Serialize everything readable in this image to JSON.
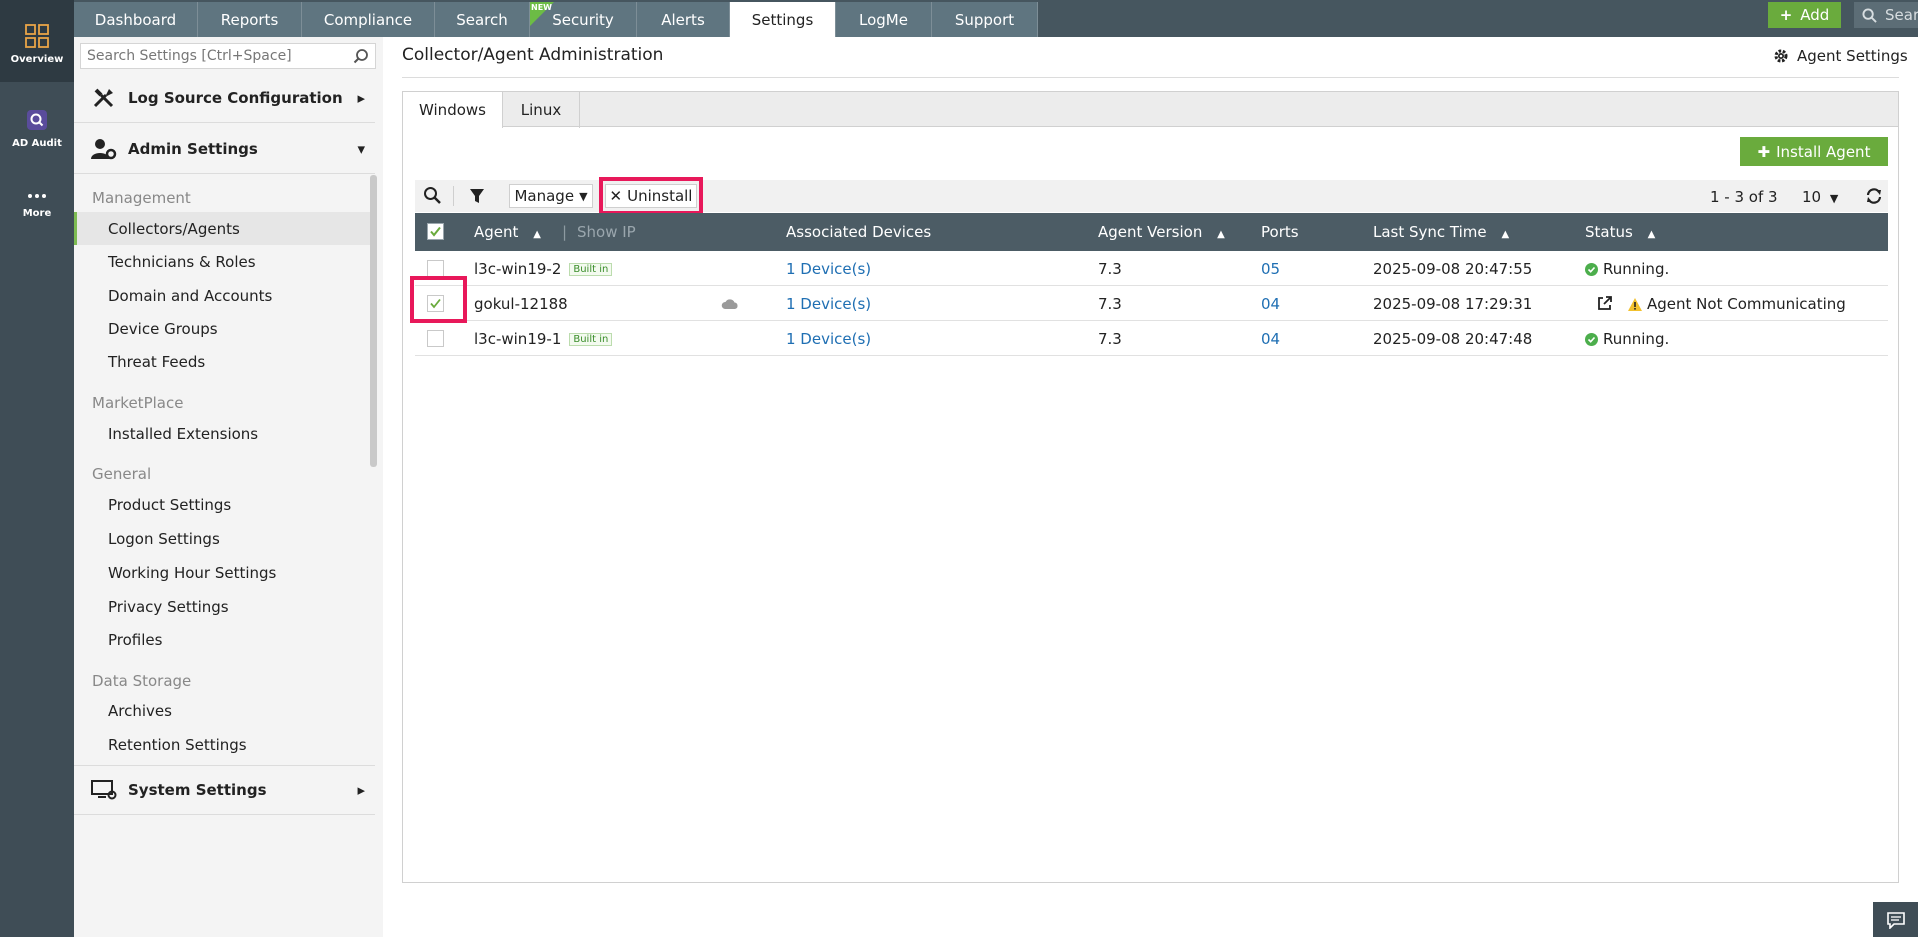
{
  "rail": {
    "items": [
      {
        "label": "Overview",
        "icon": "grid-icon"
      },
      {
        "label": "AD Audit",
        "icon": "ad-audit-icon"
      },
      {
        "label": "More",
        "icon": "more-dots-icon"
      }
    ]
  },
  "topnav": {
    "tabs": [
      "Dashboard",
      "Reports",
      "Compliance",
      "Search",
      "Security",
      "Alerts",
      "Settings",
      "LogMe",
      "Support"
    ],
    "new_badge": "NEW",
    "active_tab": "Settings",
    "add_label": "Add",
    "search_placeholder": "Search"
  },
  "sidebar": {
    "search_placeholder": "Search Settings [Ctrl+Space]",
    "sections": {
      "log_source": "Log Source Configuration",
      "admin": "Admin Settings",
      "system": "System Settings"
    },
    "groups": {
      "management": "Management",
      "marketplace": "MarketPlace",
      "general": "General",
      "data_storage": "Data Storage"
    },
    "items": {
      "collectors": "Collectors/Agents",
      "technicians": "Technicians & Roles",
      "domain": "Domain and Accounts",
      "device_groups": "Device Groups",
      "threat_feeds": "Threat Feeds",
      "installed_ext": "Installed Extensions",
      "product_settings": "Product Settings",
      "logon_settings": "Logon Settings",
      "working_hour": "Working Hour Settings",
      "privacy": "Privacy Settings",
      "profiles": "Profiles",
      "archives": "Archives",
      "retention": "Retention Settings"
    }
  },
  "main": {
    "title": "Collector/Agent Administration",
    "agent_settings": "Agent Settings",
    "os_tabs": [
      "Windows",
      "Linux"
    ],
    "install_agent": "Install Agent",
    "manage": "Manage",
    "uninstall": "Uninstall",
    "pagination": "1 - 3 of 3",
    "page_size": "10",
    "columns": {
      "agent": "Agent",
      "show_ip": "Show IP",
      "devices": "Associated Devices",
      "version": "Agent Version",
      "ports": "Ports",
      "last_sync": "Last Sync Time",
      "status": "Status"
    },
    "built_in": "Built in",
    "rows": [
      {
        "agent": "l3c-win19-2",
        "devices": "1 Device(s)",
        "version": "7.3",
        "ports": "05",
        "last_sync": "2025-09-08 20:47:55",
        "status": "Running."
      },
      {
        "agent": "gokul-12188",
        "devices": "1 Device(s)",
        "version": "7.3",
        "ports": "04",
        "last_sync": "2025-09-08 17:29:31",
        "status": "Agent Not Communicating"
      },
      {
        "agent": "l3c-win19-1",
        "devices": "1 Device(s)",
        "version": "7.3",
        "ports": "04",
        "last_sync": "2025-09-08 20:47:48",
        "status": "Running."
      }
    ]
  },
  "colors": {
    "accent_green": "#6aab3d",
    "highlight": "#e8185a",
    "link": "#1f6fb3",
    "header_bg": "#4c5c65"
  }
}
